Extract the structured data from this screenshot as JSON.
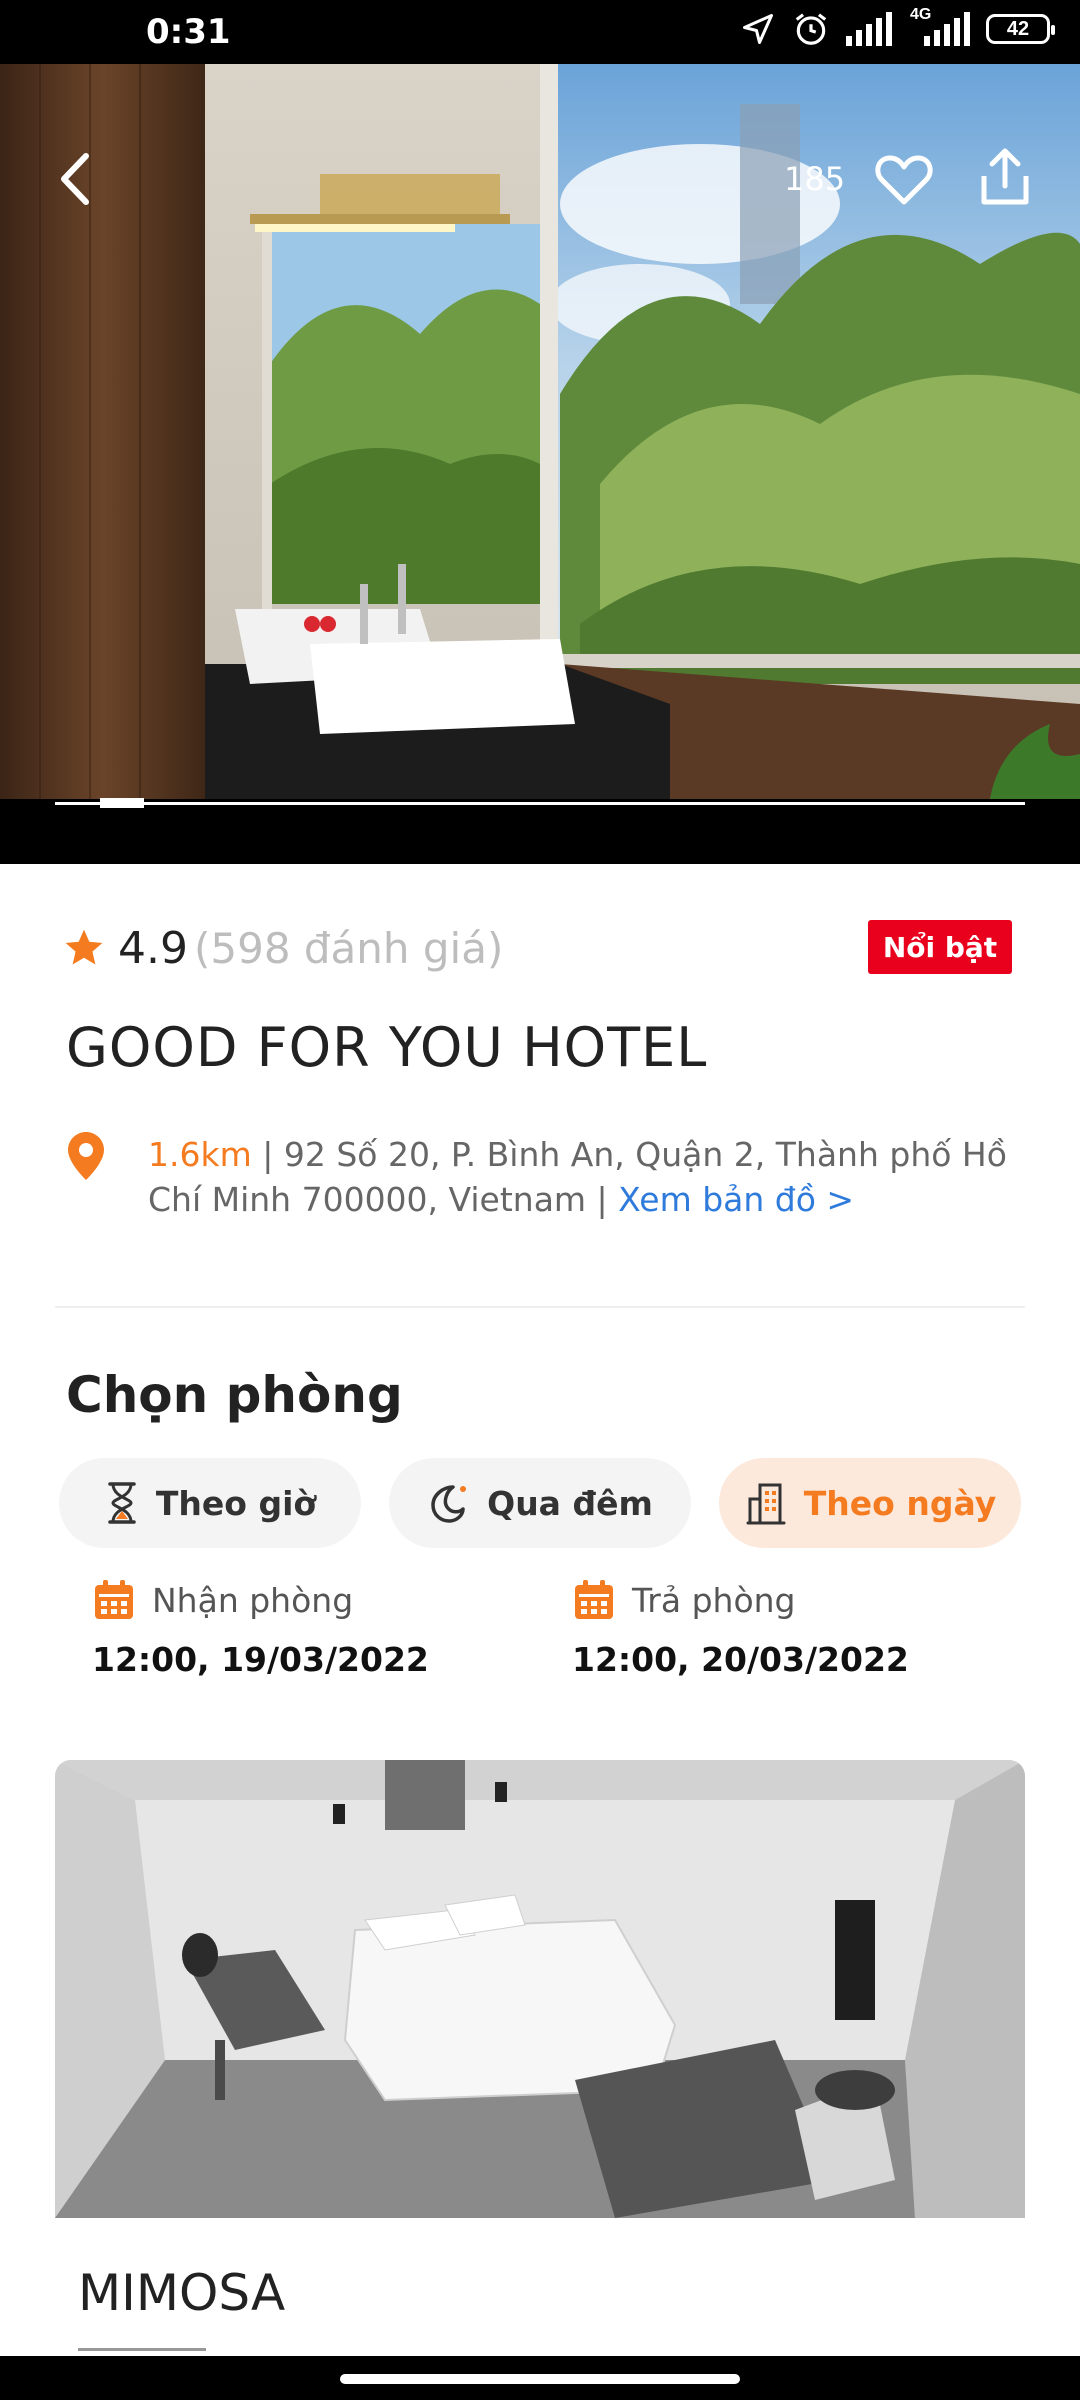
{
  "status_bar": {
    "time": "0:31",
    "network": "4G",
    "battery": "42"
  },
  "hero": {
    "like_count": "185"
  },
  "hotel": {
    "rating": "4.9",
    "review_count": "(598 đánh giá)",
    "badge": "Nổi bật",
    "name": "GOOD FOR YOU HOTEL",
    "distance": "1.6km",
    "address": " | 92 Số 20, P. Bình An, Quận 2, Thành phố Hồ Chí Minh 700000, Vietnam | ",
    "map_link": "Xem bản đồ >"
  },
  "booking": {
    "section_title": "Chọn phòng",
    "tabs": [
      {
        "label": "Theo giờ",
        "icon": "hourglass-icon"
      },
      {
        "label": "Qua đêm",
        "icon": "moon-icon"
      },
      {
        "label": "Theo ngày",
        "icon": "building-icon",
        "active": true
      }
    ],
    "check_in": {
      "label": "Nhận phòng",
      "value": "12:00, 19/03/2022"
    },
    "check_out": {
      "label": "Trả phòng",
      "value": "12:00, 20/03/2022"
    }
  },
  "room": {
    "name": "MIMOSA"
  },
  "colors": {
    "accent": "#f47b20",
    "badge": "#e8001c",
    "link": "#2f7bdc",
    "star": "#f47b20"
  }
}
